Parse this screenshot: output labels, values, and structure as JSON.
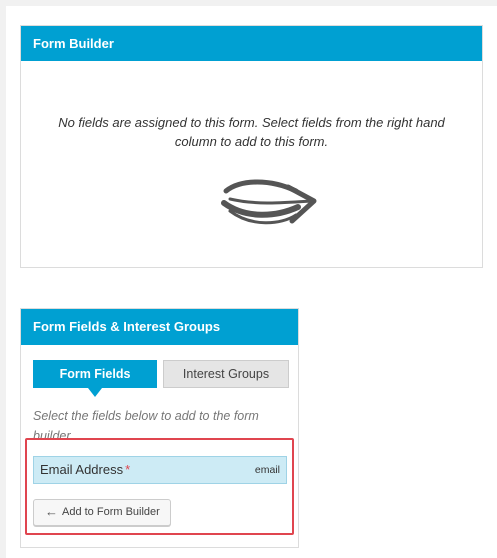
{
  "form_builder": {
    "title": "Form Builder",
    "empty_message_line1": "No fields are assigned to this form. Select fields from the right hand",
    "empty_message_line2": "column to add to this form.",
    "arrow_icon": "curved-right-arrow-icon"
  },
  "fields_panel": {
    "title": "Form Fields & Interest Groups",
    "tabs": [
      {
        "label": "Form Fields",
        "active": true
      },
      {
        "label": "Interest Groups",
        "active": false
      }
    ],
    "help_text": "Select the fields below to add to the form builder.",
    "fields": [
      {
        "name": "Email Address",
        "required_marker": "*",
        "type": "email"
      }
    ],
    "add_button_label": "Add to Form Builder",
    "add_button_icon": "left-arrow-icon"
  },
  "colors": {
    "accent": "#00a0d2",
    "highlight": "#e0454f",
    "field_bg": "#cdebf5"
  }
}
